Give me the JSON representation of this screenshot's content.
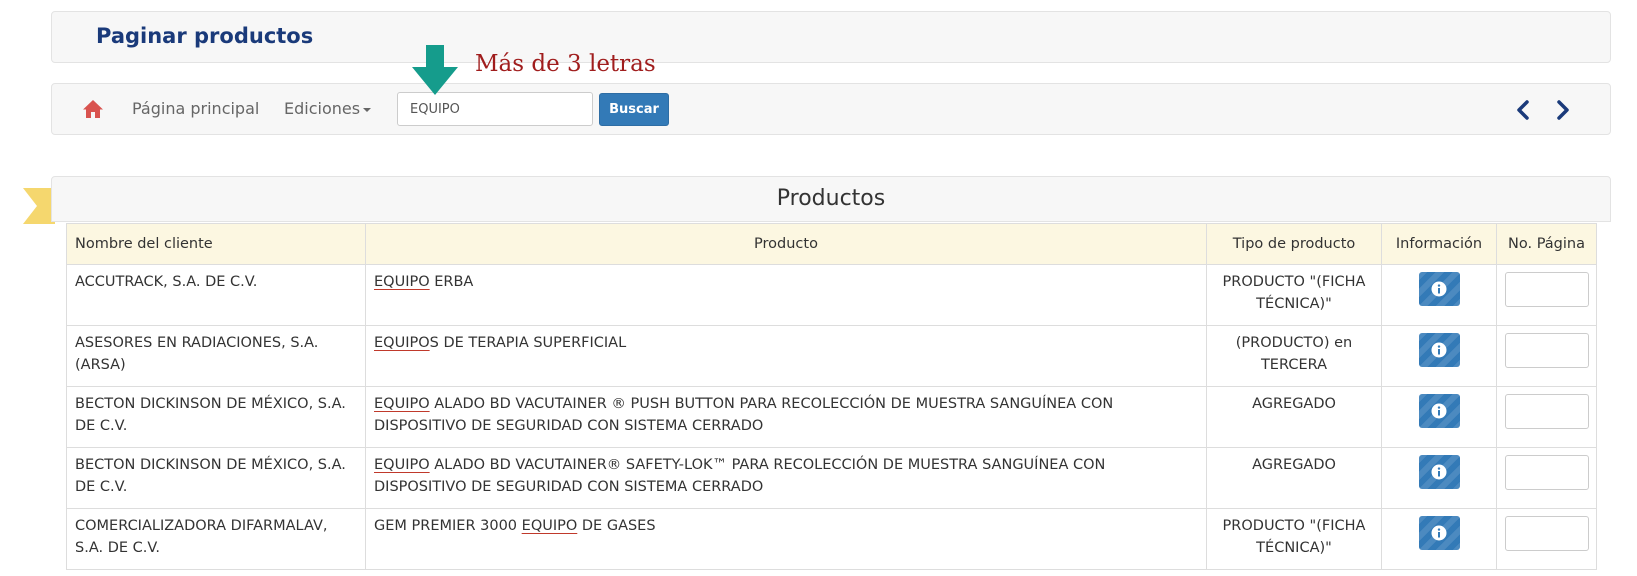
{
  "page": {
    "title": "Paginar productos"
  },
  "navbar": {
    "home_link": "Página principal",
    "editions_menu": "Ediciones",
    "search": {
      "value": "EQUIPO"
    },
    "search_button": "Buscar"
  },
  "annotation": {
    "text": "Más de 3 letras"
  },
  "panel": {
    "title": "Productos"
  },
  "table": {
    "headers": {
      "client": "Nombre del cliente",
      "product": "Producto",
      "type": "Tipo de producto",
      "info": "Información",
      "page": "No. Página"
    },
    "rows": [
      {
        "client": "ACCUTRACK, S.A. DE C.V.",
        "product_before": "",
        "product_match": "EQUIPO",
        "product_after": " ERBA",
        "type": "PRODUCTO \"(FICHA TÉCNICA)\""
      },
      {
        "client": "ASESORES EN RADIACIONES, S.A. (ARSA)",
        "product_before": "",
        "product_match": "EQUIPO",
        "product_after": "S DE TERAPIA SUPERFICIAL",
        "type": "(PRODUCTO) en TERCERA"
      },
      {
        "client": "BECTON DICKINSON DE MÉXICO, S.A. DE C.V.",
        "product_before": "",
        "product_match": "EQUIPO",
        "product_after": " ALADO BD VACUTAINER ® PUSH BUTTON PARA RECOLECCIÓN DE MUESTRA SANGUÍNEA CON DISPOSITIVO DE SEGURIDAD CON SISTEMA CERRADO",
        "type": "AGREGADO"
      },
      {
        "client": "BECTON DICKINSON DE MÉXICO, S.A. DE C.V.",
        "product_before": "",
        "product_match": "EQUIPO",
        "product_after": " ALADO BD VACUTAINER® SAFETY-LOK™ PARA RECOLECCIÓN DE MUESTRA SANGUÍNEA CON DISPOSITIVO DE SEGURIDAD CON SISTEMA CERRADO",
        "type": "AGREGADO"
      },
      {
        "client": "COMERCIALIZADORA DIFARMALAV, S.A. DE C.V.",
        "product_before": "GEM PREMIER 3000 ",
        "product_match": "EQUIPO",
        "product_after": " DE GASES",
        "type": "PRODUCTO \"(FICHA TÉCNICA)\""
      }
    ]
  },
  "colors": {
    "title": "#1a3a7a",
    "accent": "#337ab7",
    "home_icon": "#d9534f",
    "annotation_text": "#a01d1d",
    "annotation_arrow": "#159c8c",
    "header_row": "#fcf7e1",
    "bookmark": "#f5d76e",
    "highlight_underline": "#c0392b"
  },
  "icons": {
    "home": "home-icon",
    "prev": "chevron-left-icon",
    "next": "chevron-right-icon",
    "info": "info-circle-icon",
    "arrow": "arrow-down-icon",
    "bookmark": "bookmark-icon"
  }
}
